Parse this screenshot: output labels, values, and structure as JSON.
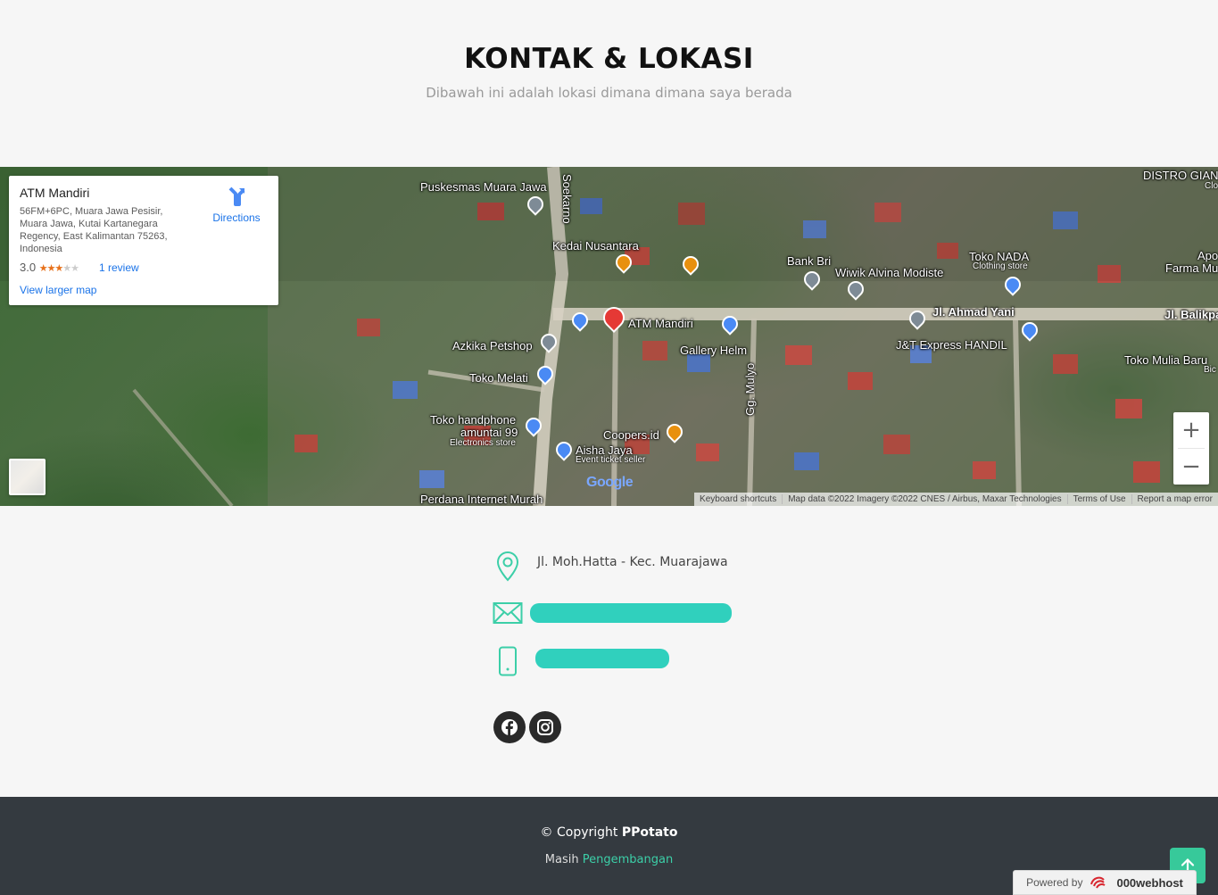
{
  "section": {
    "title": "KONTAK & LOKASI",
    "subtitle": "Dibawah ini adalah lokasi dimana dimana saya berada"
  },
  "map": {
    "info_card": {
      "title": "ATM Mandiri",
      "address": "56FM+6PC, Muara Jawa Pesisir, Muara Jawa, Kutai Kartanegara Regency, East Kalimantan 75263, Indonesia",
      "rating": "3.0",
      "rating_value": 3,
      "rating_max": 5,
      "stars": "★★★",
      "stars_off": "★★",
      "reviews": "1 review",
      "larger_map": "View larger map",
      "directions": "Directions"
    },
    "labels": {
      "puskesmas": "Puskesmas Muara Jawa",
      "soekarno": "Soekarno",
      "kedai": "Kedai Nusantara",
      "bank_bri": "Bank Bri",
      "wiwik": "Wiwik Alvina Modiste",
      "toko_nada": "Toko NADA",
      "toko_nada_sub": "Clothing store",
      "distro": "DISTRO GIAN",
      "distro_sub": "Clo",
      "apo": "Apo",
      "farma": "Farma Mu",
      "atm": "ATM Mandiri",
      "azkika": "Azkika Petshop",
      "gallery": "Gallery Helm",
      "ahmad_yani": "Jl. Ahmad Yani",
      "balikpa": "Jl. Balikpa",
      "jt": "J&T Express HANDIL",
      "toko_melati": "Toko Melati",
      "mulyo": "Gg. Mulyo",
      "toko_mulia": "Toko Mulia Baru",
      "toko_mulia_sub": "Bic",
      "toko_hp": "Toko handphone",
      "toko_hp_2": "amuntai 99",
      "toko_hp_sub": "Electronics store",
      "coopers": "Coopers.id",
      "aisha": "Aisha Jaya",
      "aisha_sub": "Event ticket seller",
      "perdana": "Perdana Internet Murah"
    },
    "zoom_in": "+",
    "zoom_out": "−",
    "google": "Google",
    "attribution": {
      "shortcuts": "Keyboard shortcuts",
      "data": "Map data ©2022 Imagery ©2022 CNES / Airbus, Maxar Technologies",
      "terms": "Terms of Use",
      "report": "Report a map error"
    }
  },
  "contact": {
    "address": "Jl. Moh.Hatta - Kec. Muarajawa",
    "accent_color": "#3ccfa8"
  },
  "footer": {
    "copyright_prefix": "© Copyright ",
    "copyright_name": "PPotato",
    "credits_prefix": "Masih ",
    "credits_link": "Pengembangan",
    "powered_by": "Powered by",
    "host": "000webhost"
  }
}
